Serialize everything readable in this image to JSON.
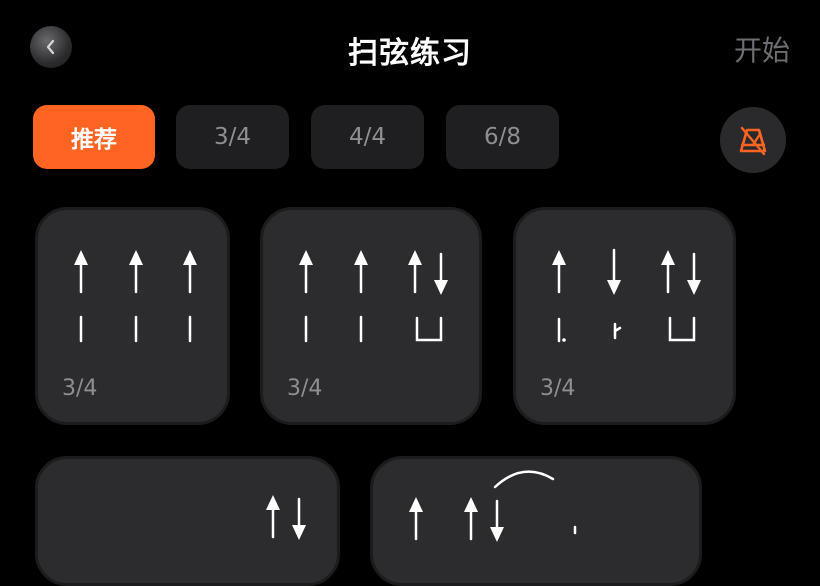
{
  "header": {
    "title": "扫弦练习",
    "start_label": "开始"
  },
  "tabs": [
    {
      "label": "推荐",
      "active": true
    },
    {
      "label": "3/4",
      "active": false
    },
    {
      "label": "4/4",
      "active": false
    },
    {
      "label": "6/8",
      "active": false
    }
  ],
  "patterns": [
    {
      "time_signature": "3/4"
    },
    {
      "time_signature": "3/4"
    },
    {
      "time_signature": "3/4"
    },
    {
      "time_signature": ""
    },
    {
      "time_signature": ""
    }
  ],
  "colors": {
    "accent": "#ff6422",
    "background": "#000000",
    "card": "#2c2c2f",
    "tab_bg": "#1f1f22",
    "muted_text": "#8e8e93"
  },
  "icons": {
    "back": "back-icon",
    "metronome": "metronome-off-icon"
  }
}
